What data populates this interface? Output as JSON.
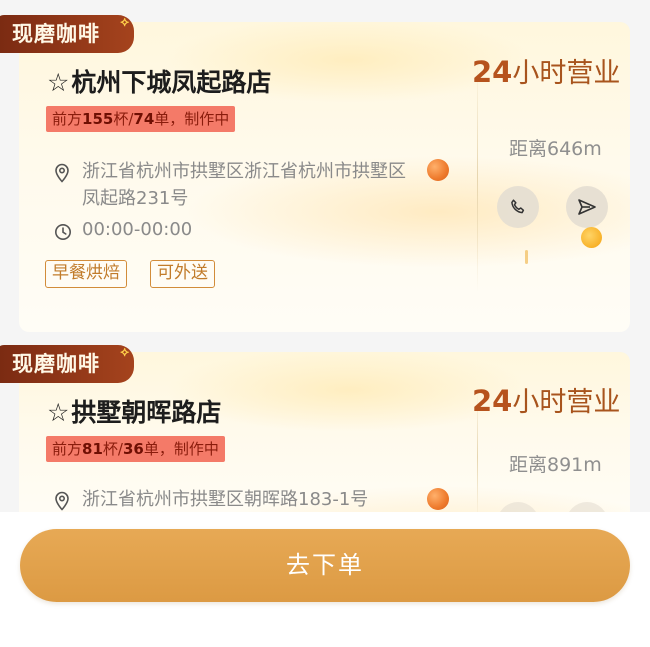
{
  "stores": [
    {
      "badge": "现磨咖啡",
      "name": "杭州下城凤起路店",
      "queue": {
        "prefix": "前方",
        "cups": "155",
        "cups_unit": "杯/",
        "orders": "74",
        "suffix": "单，制作中"
      },
      "address": "浙江省杭州市拱墅区浙江省杭州市拱墅区凤起路231号",
      "hours": "00:00-00:00",
      "tags": [
        "早餐烘焙",
        "可外送"
      ],
      "open_label": {
        "num": "24",
        "text": "小时营业"
      },
      "distance": "距离646m"
    },
    {
      "badge": "现磨咖啡",
      "name": "拱墅朝晖路店",
      "queue": {
        "prefix": "前方",
        "cups": "81",
        "cups_unit": "杯/",
        "orders": "36",
        "suffix": "单，制作中"
      },
      "address": "浙江省杭州市拱墅区朝晖路183-1号",
      "open_label": {
        "num": "24",
        "text": "小时营业"
      },
      "distance": "距离891m"
    }
  ],
  "star_glyph": "☆",
  "spark_glyph": "⟡",
  "icons": {
    "location": "location-pin-icon",
    "clock": "clock-icon",
    "phone": "phone-icon",
    "navigate": "navigate-arrow-icon"
  },
  "order_button": "去下单",
  "colors": {
    "accent": "#dc9a43",
    "badge": "#7a2a12",
    "queue_bg": "#f47a68",
    "open_label": "#a8541d",
    "tag_border": "#d28c3a"
  }
}
